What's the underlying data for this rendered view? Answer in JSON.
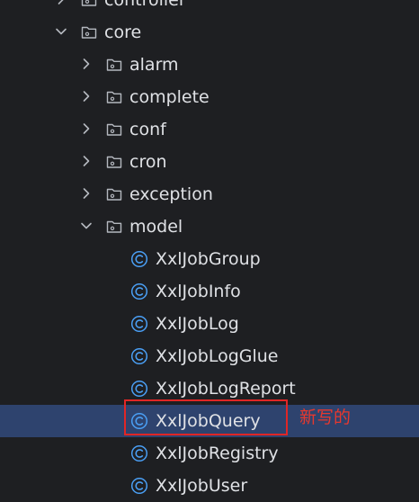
{
  "tree": [
    {
      "label": "controller",
      "kind": "folder",
      "state": "collapsed",
      "depth": 1,
      "icon": "folder-icon"
    },
    {
      "label": "core",
      "kind": "folder",
      "state": "expanded",
      "depth": 1,
      "icon": "folder-icon"
    },
    {
      "label": "alarm",
      "kind": "folder",
      "state": "collapsed",
      "depth": 2,
      "icon": "folder-icon"
    },
    {
      "label": "complete",
      "kind": "folder",
      "state": "collapsed",
      "depth": 2,
      "icon": "folder-icon"
    },
    {
      "label": "conf",
      "kind": "folder",
      "state": "collapsed",
      "depth": 2,
      "icon": "folder-icon"
    },
    {
      "label": "cron",
      "kind": "folder",
      "state": "collapsed",
      "depth": 2,
      "icon": "folder-icon"
    },
    {
      "label": "exception",
      "kind": "folder",
      "state": "collapsed",
      "depth": 2,
      "icon": "folder-icon"
    },
    {
      "label": "model",
      "kind": "folder",
      "state": "expanded",
      "depth": 2,
      "icon": "folder-icon"
    },
    {
      "label": "XxlJobGroup",
      "kind": "class",
      "depth": 3,
      "icon": "java-class-icon"
    },
    {
      "label": "XxlJobInfo",
      "kind": "class",
      "depth": 3,
      "icon": "java-class-icon"
    },
    {
      "label": "XxlJobLog",
      "kind": "class",
      "depth": 3,
      "icon": "java-class-icon"
    },
    {
      "label": "XxlJobLogGlue",
      "kind": "class",
      "depth": 3,
      "icon": "java-class-icon"
    },
    {
      "label": "XxlJobLogReport",
      "kind": "class",
      "depth": 3,
      "icon": "java-class-icon"
    },
    {
      "label": "XxlJobQuery",
      "kind": "class",
      "depth": 3,
      "icon": "java-class-icon",
      "selected": true
    },
    {
      "label": "XxlJobRegistry",
      "kind": "class",
      "depth": 3,
      "icon": "java-class-icon"
    },
    {
      "label": "XxlJobUser",
      "kind": "class",
      "depth": 3,
      "icon": "java-class-icon"
    }
  ],
  "annotation": {
    "text": "新写的",
    "color": "#e8382e"
  },
  "colors": {
    "background": "#1e1f22",
    "selection": "#2e436e",
    "text": "#dfe1e5",
    "icon": "#b4b8bf",
    "class_icon": "#4a9ff5",
    "highlight_border": "#e02626"
  }
}
